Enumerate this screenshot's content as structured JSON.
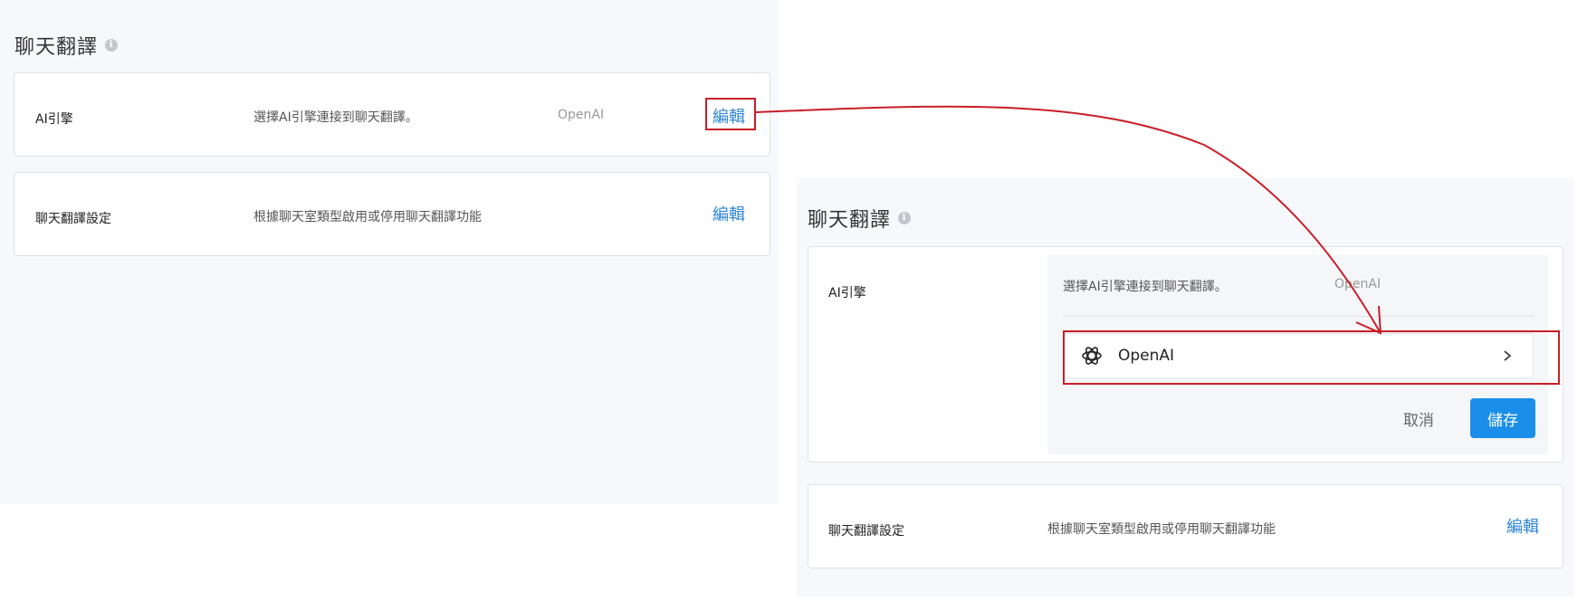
{
  "section": {
    "title": "聊天翻譯"
  },
  "rows": {
    "ai_engine": {
      "label": "AI引擎",
      "description": "選擇AI引擎連接到聊天翻譯。",
      "value": "OpenAI",
      "edit_label": "編輯"
    },
    "translation_settings": {
      "label": "聊天翻譯設定",
      "description": "根據聊天室類型啟用或停用聊天翻譯功能",
      "edit_label": "編輯"
    }
  },
  "editor": {
    "option_label": "OpenAI",
    "option_icon": "openai-logo-icon",
    "cancel_label": "取消",
    "save_label": "儲存"
  },
  "colors": {
    "accent": "#1a8ee8",
    "link": "#2f86d6",
    "highlight": "#c81e28"
  }
}
